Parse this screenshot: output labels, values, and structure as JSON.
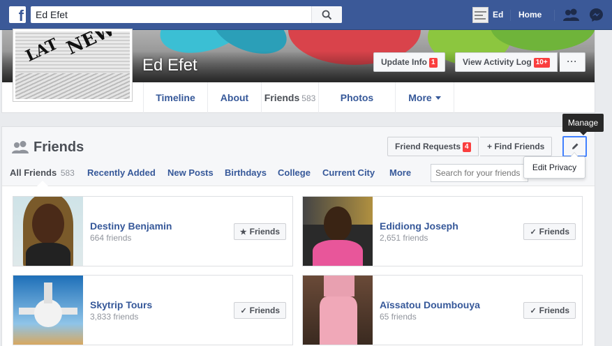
{
  "topbar": {
    "logo": "f",
    "search_value": "Ed Efet",
    "user_name": "Ed",
    "home_label": "Home",
    "icons": [
      "search-icon",
      "friend-requests-icon",
      "messenger-icon"
    ]
  },
  "profile": {
    "name": "Ed Efet",
    "update_info_label": "Update Info",
    "update_info_badge": "1",
    "activity_log_label": "View Activity Log",
    "activity_log_badge": "10+",
    "more_label": "···",
    "tabs": [
      {
        "label": "Timeline"
      },
      {
        "label": "About"
      },
      {
        "label": "Friends",
        "count": "583"
      },
      {
        "label": "Photos"
      },
      {
        "label": "More"
      }
    ]
  },
  "friends": {
    "title": "Friends",
    "friend_requests_label": "Friend Requests",
    "friend_requests_badge": "4",
    "find_friends_label": "+ Find Friends",
    "tooltip": "Manage",
    "dropdown_item": "Edit Privacy",
    "search_placeholder": "Search for your friends",
    "subtabs": [
      {
        "label": "All Friends",
        "count": "583"
      },
      {
        "label": "Recently Added"
      },
      {
        "label": "New Posts"
      },
      {
        "label": "Birthdays"
      },
      {
        "label": "College"
      },
      {
        "label": "Current City"
      },
      {
        "label": "More"
      }
    ],
    "list": [
      {
        "name": "Destiny Benjamin",
        "sub": "664 friends",
        "button": "Friends",
        "button_icon": "★"
      },
      {
        "name": "Edidiong Joseph",
        "sub": "2,651 friends",
        "button": "Friends",
        "button_icon": "✓"
      },
      {
        "name": "Skytrip Tours",
        "sub": "3,833 friends",
        "button": "Friends",
        "button_icon": "✓"
      },
      {
        "name": "Aïssatou Doumbouya",
        "sub": "65 friends",
        "button": "Friends",
        "button_icon": "✓"
      }
    ]
  },
  "colors": {
    "brand": "#3b5998",
    "link": "#365899",
    "badge": "#fa3e3e",
    "focus": "#4080ff"
  }
}
